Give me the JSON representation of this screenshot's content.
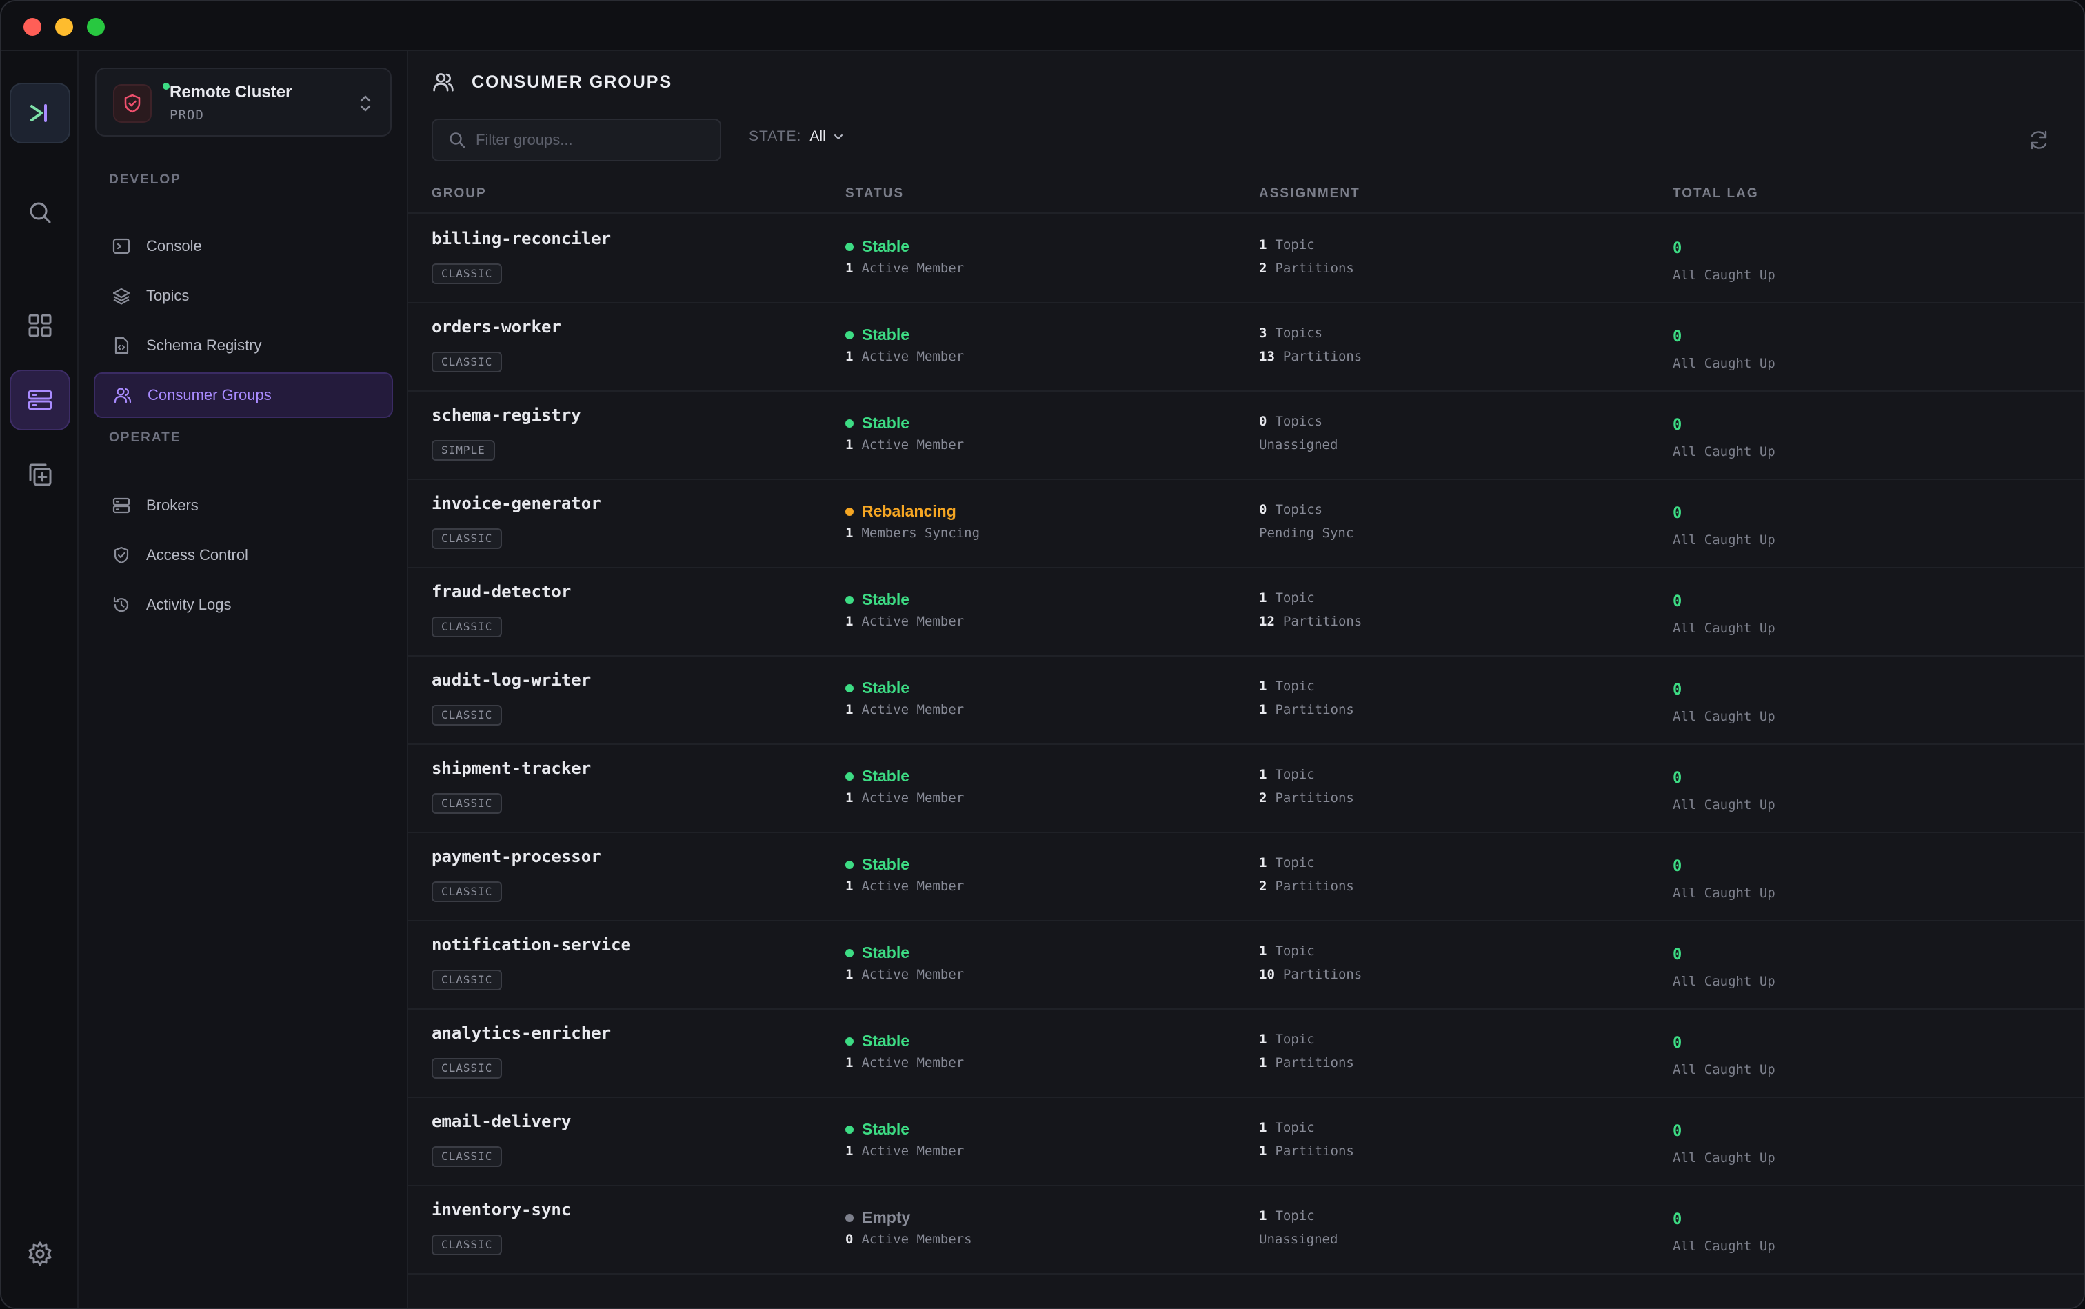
{
  "colors": {
    "accent": "#a98bff",
    "stable": "#3ddc84",
    "rebalancing": "#f5a623",
    "empty": "#7d808c"
  },
  "cluster": {
    "name": "Remote Cluster",
    "env": "PROD"
  },
  "sidebar": {
    "develop_label": "DEVELOP",
    "operate_label": "OPERATE",
    "develop": [
      {
        "label": "Console",
        "icon": "terminal-icon"
      },
      {
        "label": "Topics",
        "icon": "layers-icon"
      },
      {
        "label": "Schema Registry",
        "icon": "file-code-icon"
      },
      {
        "label": "Consumer Groups",
        "icon": "users-icon",
        "active": true
      }
    ],
    "operate": [
      {
        "label": "Brokers",
        "icon": "server-icon"
      },
      {
        "label": "Access Control",
        "icon": "shield-check-icon"
      },
      {
        "label": "Activity Logs",
        "icon": "history-icon"
      }
    ]
  },
  "header": {
    "title": "CONSUMER GROUPS"
  },
  "filter": {
    "placeholder": "Filter groups...",
    "value": ""
  },
  "state": {
    "label": "STATE:",
    "value": "All"
  },
  "columns": {
    "group": "GROUP",
    "status": "STATUS",
    "assignment": "ASSIGNMENT",
    "lag": "TOTAL LAG"
  },
  "groups": [
    {
      "name": "billing-reconciler",
      "type": "CLASSIC",
      "status": "Stable",
      "status_kind": "stable",
      "members_count": "1",
      "members_text": "Active Member",
      "topics_count": "1",
      "topics_text": "Topic",
      "partitions_count": "2",
      "partitions_text": "Partitions",
      "lag": "0",
      "lag_text": "All Caught Up"
    },
    {
      "name": "orders-worker",
      "type": "CLASSIC",
      "status": "Stable",
      "status_kind": "stable",
      "members_count": "1",
      "members_text": "Active Member",
      "topics_count": "3",
      "topics_text": "Topics",
      "partitions_count": "13",
      "partitions_text": "Partitions",
      "lag": "0",
      "lag_text": "All Caught Up"
    },
    {
      "name": "schema-registry",
      "type": "SIMPLE",
      "status": "Stable",
      "status_kind": "stable",
      "members_count": "1",
      "members_text": "Active Member",
      "topics_count": "0",
      "topics_text": "Topics",
      "partitions_count": "",
      "partitions_text": "Unassigned",
      "lag": "0",
      "lag_text": "All Caught Up"
    },
    {
      "name": "invoice-generator",
      "type": "CLASSIC",
      "status": "Rebalancing",
      "status_kind": "rebalancing",
      "members_count": "1",
      "members_text": "Members Syncing",
      "topics_count": "0",
      "topics_text": "Topics",
      "partitions_count": "",
      "partitions_text": "Pending Sync",
      "lag": "0",
      "lag_text": "All Caught Up"
    },
    {
      "name": "fraud-detector",
      "type": "CLASSIC",
      "status": "Stable",
      "status_kind": "stable",
      "members_count": "1",
      "members_text": "Active Member",
      "topics_count": "1",
      "topics_text": "Topic",
      "partitions_count": "12",
      "partitions_text": "Partitions",
      "lag": "0",
      "lag_text": "All Caught Up"
    },
    {
      "name": "audit-log-writer",
      "type": "CLASSIC",
      "status": "Stable",
      "status_kind": "stable",
      "members_count": "1",
      "members_text": "Active Member",
      "topics_count": "1",
      "topics_text": "Topic",
      "partitions_count": "1",
      "partitions_text": "Partitions",
      "lag": "0",
      "lag_text": "All Caught Up"
    },
    {
      "name": "shipment-tracker",
      "type": "CLASSIC",
      "status": "Stable",
      "status_kind": "stable",
      "members_count": "1",
      "members_text": "Active Member",
      "topics_count": "1",
      "topics_text": "Topic",
      "partitions_count": "2",
      "partitions_text": "Partitions",
      "lag": "0",
      "lag_text": "All Caught Up"
    },
    {
      "name": "payment-processor",
      "type": "CLASSIC",
      "status": "Stable",
      "status_kind": "stable",
      "members_count": "1",
      "members_text": "Active Member",
      "topics_count": "1",
      "topics_text": "Topic",
      "partitions_count": "2",
      "partitions_text": "Partitions",
      "lag": "0",
      "lag_text": "All Caught Up"
    },
    {
      "name": "notification-service",
      "type": "CLASSIC",
      "status": "Stable",
      "status_kind": "stable",
      "members_count": "1",
      "members_text": "Active Member",
      "topics_count": "1",
      "topics_text": "Topic",
      "partitions_count": "10",
      "partitions_text": "Partitions",
      "lag": "0",
      "lag_text": "All Caught Up"
    },
    {
      "name": "analytics-enricher",
      "type": "CLASSIC",
      "status": "Stable",
      "status_kind": "stable",
      "members_count": "1",
      "members_text": "Active Member",
      "topics_count": "1",
      "topics_text": "Topic",
      "partitions_count": "1",
      "partitions_text": "Partitions",
      "lag": "0",
      "lag_text": "All Caught Up"
    },
    {
      "name": "email-delivery",
      "type": "CLASSIC",
      "status": "Stable",
      "status_kind": "stable",
      "members_count": "1",
      "members_text": "Active Member",
      "topics_count": "1",
      "topics_text": "Topic",
      "partitions_count": "1",
      "partitions_text": "Partitions",
      "lag": "0",
      "lag_text": "All Caught Up"
    },
    {
      "name": "inventory-sync",
      "type": "CLASSIC",
      "status": "Empty",
      "status_kind": "empty",
      "members_count": "0",
      "members_text": "Active Members",
      "topics_count": "1",
      "topics_text": "Topic",
      "partitions_count": "",
      "partitions_text": "Unassigned",
      "lag": "0",
      "lag_text": "All Caught Up"
    }
  ]
}
